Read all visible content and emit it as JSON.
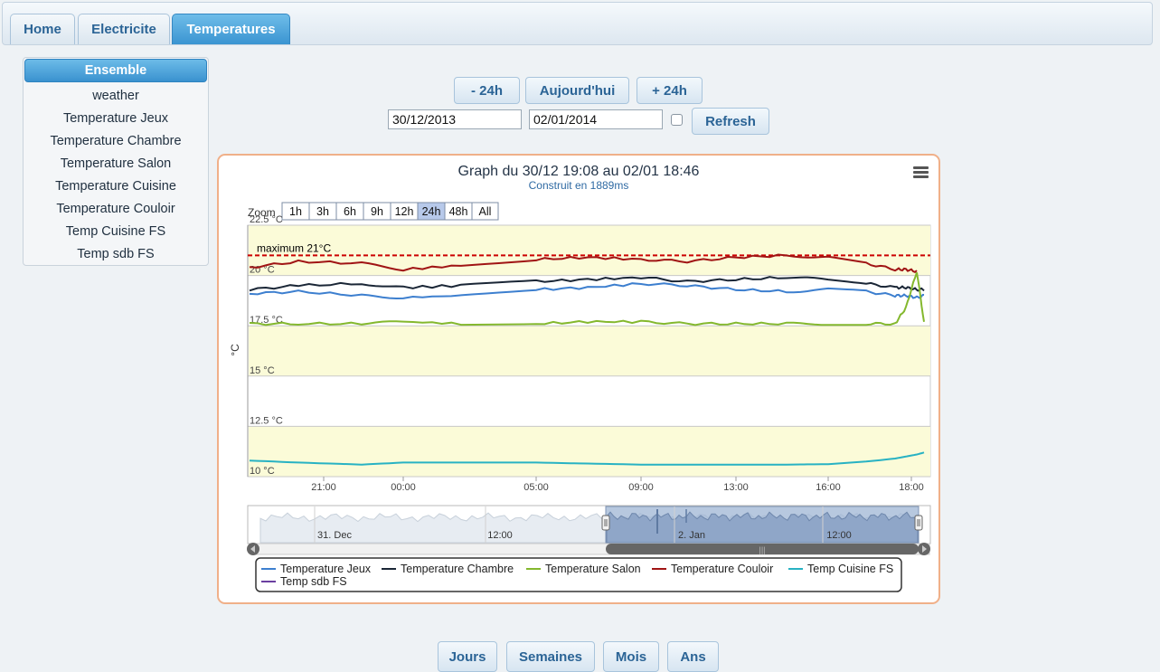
{
  "tabs": [
    {
      "label": "Home",
      "active": false
    },
    {
      "label": "Electricite",
      "active": false
    },
    {
      "label": "Temperatures",
      "active": true
    }
  ],
  "sidebar": {
    "items": [
      {
        "label": "Ensemble",
        "active": true
      },
      {
        "label": "weather",
        "active": false
      },
      {
        "label": "Temperature Jeux",
        "active": false
      },
      {
        "label": "Temperature Chambre",
        "active": false
      },
      {
        "label": "Temperature Salon",
        "active": false
      },
      {
        "label": "Temperature Cuisine",
        "active": false
      },
      {
        "label": "Temperature Couloir",
        "active": false
      },
      {
        "label": "Temp Cuisine FS",
        "active": false
      },
      {
        "label": "Temp sdb FS",
        "active": false
      }
    ]
  },
  "controls": {
    "prev_label": "- 24h",
    "today_label": "Aujourd'hui",
    "next_label": "+ 24h",
    "start_date": "30/12/2013",
    "end_date": "02/01/2014",
    "checkbox_checked": false,
    "refresh_label": "Refresh"
  },
  "chart": {
    "menu_icon": "hamburger-menu-icon",
    "zoom_label": "Zoom",
    "zoom_buttons": [
      "1h",
      "3h",
      "6h",
      "9h",
      "12h",
      "24h",
      "48h",
      "All"
    ],
    "zoom_selected": "24h",
    "navigator_labels": [
      "31. Dec",
      "12:00",
      "2. Jan",
      "12:00"
    ]
  },
  "chart_data": {
    "type": "line",
    "title": "Graph du 30/12 19:08 au 02/01 18:46",
    "subtitle": "Construit en 1889ms",
    "ylabel": "°C",
    "ylim": [
      10,
      22.5
    ],
    "yticks": [
      "22.5 °C",
      "20 °C",
      "17.5 °C",
      "15 °C",
      "12.5 °C",
      "10 °C"
    ],
    "x_tick_labels": [
      "21:00",
      "00:00",
      "05:00",
      "09:00",
      "13:00",
      "16:00",
      "18:00"
    ],
    "plot_bands_y": [
      [
        20,
        22.5
      ],
      [
        17.5,
        15
      ],
      [
        12.5,
        10
      ]
    ],
    "plot_line": {
      "value": 21,
      "label": "maximum 21°C",
      "color": "#cc0000"
    },
    "x": [
      "01/01 19:00",
      "01/01 21:00",
      "01/01 23:00",
      "02/01 00:00",
      "02/01 02:00",
      "02/01 05:00",
      "02/01 07:00",
      "02/01 09:00",
      "02/01 11:00",
      "02/01 13:00",
      "02/01 15:00",
      "02/01 16:00",
      "02/01 17:00",
      "02/01 17:45",
      "02/01 18:00",
      "02/01 18:20",
      "02/01 18:40"
    ],
    "series": [
      {
        "name": "Temperature Jeux",
        "color": "#3d7fcf",
        "values": [
          19.1,
          19.2,
          19.0,
          18.9,
          19.0,
          19.3,
          19.4,
          19.6,
          19.5,
          19.3,
          19.2,
          19.3,
          19.2,
          19.0,
          19.0,
          18.9,
          19.0
        ]
      },
      {
        "name": "Temperature Chambre",
        "color": "#1a2636",
        "values": [
          19.3,
          19.5,
          19.6,
          19.4,
          19.5,
          19.7,
          19.8,
          19.9,
          19.7,
          19.8,
          19.9,
          19.8,
          19.6,
          19.4,
          19.4,
          19.3,
          19.3
        ]
      },
      {
        "name": "Temperature Salon",
        "color": "#84b82e",
        "values": [
          17.6,
          17.6,
          17.6,
          17.7,
          17.6,
          17.6,
          17.7,
          17.7,
          17.6,
          17.6,
          17.6,
          17.6,
          17.6,
          17.6,
          18.4,
          20.2,
          17.7
        ]
      },
      {
        "name": "Temperature Couloir",
        "color": "#a01414",
        "values": [
          20.4,
          20.7,
          20.6,
          20.3,
          20.5,
          20.8,
          20.9,
          20.8,
          20.7,
          20.9,
          21.0,
          20.9,
          20.6,
          20.3,
          20.3,
          20.2,
          null
        ]
      },
      {
        "name": "Temp Cuisine FS",
        "color": "#28b2c3",
        "values": [
          10.8,
          10.7,
          10.6,
          10.7,
          10.7,
          10.7,
          10.65,
          10.6,
          10.6,
          10.6,
          10.6,
          10.62,
          10.75,
          10.9,
          11.0,
          11.1,
          11.2
        ]
      },
      {
        "name": "Temp sdb FS",
        "color": "#6a3fa0",
        "values": []
      }
    ],
    "legend_placement": "bottom",
    "grid": true
  },
  "bottom_buttons": [
    "Jours",
    "Semaines",
    "Mois",
    "Ans"
  ]
}
